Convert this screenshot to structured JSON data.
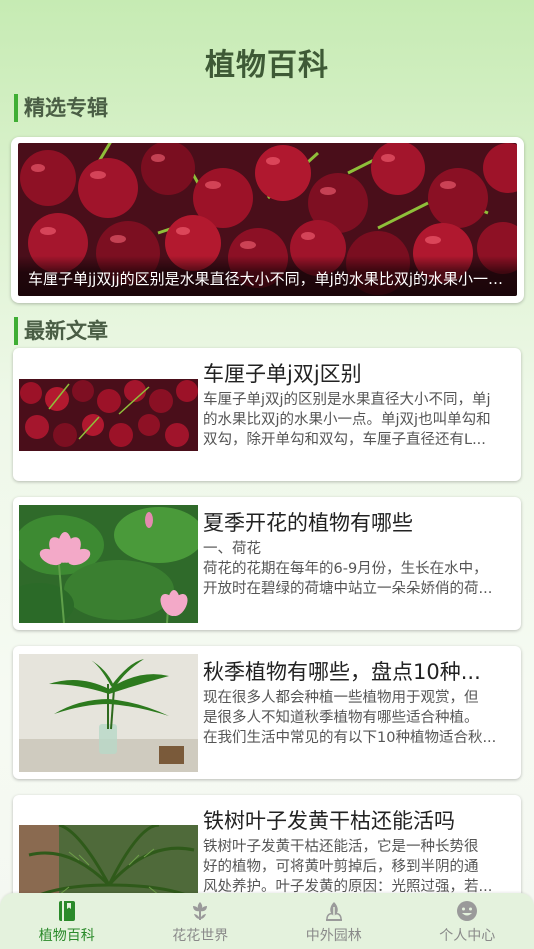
{
  "header": {
    "title": "植物百科"
  },
  "sections": {
    "featured_heading": "精选专辑",
    "latest_heading": "最新文章"
  },
  "featured": {
    "caption": "车厘子单jj双jj的区别是水果直径大小不同，单j的水果比双j的水果小一点。"
  },
  "articles": [
    {
      "title": "车厘子单j双j区别",
      "summary_lines": [
        "车厘子单j双j的区别是水果直径大小不同，单j",
        "的水果比双j的水果小一点。单j双j也叫单勾和",
        "双勾，除开单勾和双勾，车厘子直径还有L..."
      ]
    },
    {
      "title": "夏季开花的植物有哪些",
      "summary_lines": [
        "一、荷花",
        "荷花的花期在每年的6-9月份，生长在水中，",
        "开放时在碧绿的荷塘中站立一朵朵娇俏的荷..."
      ]
    },
    {
      "title": "秋季植物有哪些，盘点10种...",
      "summary_lines": [
        "现在很多人都会种植一些植物用于观赏，但",
        "是很多人不知道秋季植物有哪些适合种植。",
        "在我们生活中常见的有以下10种植物适合秋..."
      ]
    },
    {
      "title": "铁树叶子发黄干枯还能活吗",
      "summary_lines": [
        "铁树叶子发黄干枯还能活，它是一种长势很",
        "好的植物，可将黄叶剪掉后，移到半阴的通",
        "风处养护。叶子发黄的原因：光照过强，若..."
      ]
    }
  ],
  "tabbar": {
    "items": [
      {
        "label": "植物百科",
        "icon": "book-icon",
        "active": true
      },
      {
        "label": "花花世界",
        "icon": "flower-icon",
        "active": false
      },
      {
        "label": "中外园林",
        "icon": "garden-icon",
        "active": false
      },
      {
        "label": "个人中心",
        "icon": "smiley-icon",
        "active": false
      }
    ]
  },
  "colors": {
    "accent": "#3fae34",
    "active_tab": "#2a8a2a",
    "inactive_tab": "#8a8a8a"
  }
}
